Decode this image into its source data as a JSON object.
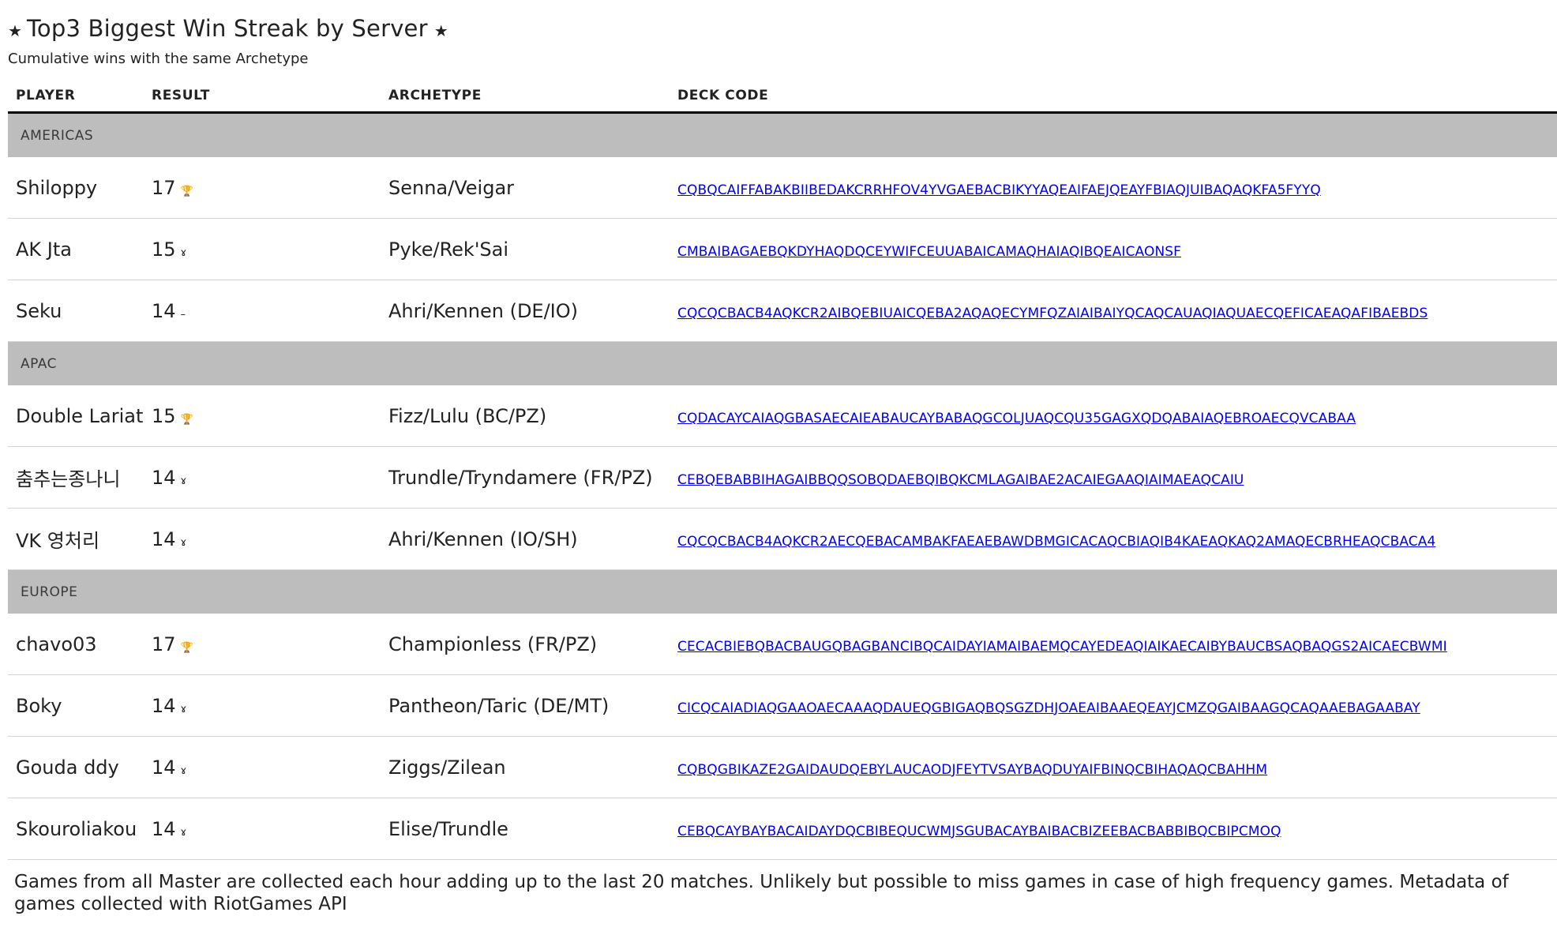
{
  "header": {
    "title": "Top3 Biggest Win Streak by Server",
    "subtitle": "Cumulative wins with the same Archetype",
    "star_icon": "★"
  },
  "table": {
    "columns": [
      "PLAYER",
      "RESULT",
      "ARCHETYPE",
      "DECK CODE"
    ],
    "groups": [
      {
        "name": "AMERICAS",
        "rows": [
          {
            "player": "Shiloppy",
            "result": "17",
            "icon": "trophy-icon",
            "archetype": "Senna/Veigar",
            "deck": "CQBQCAIFFABAKBIIBEDAKCRRHFOV4YVGAEBACBIKYYAQEAIFAEJQEAYFBIAQJUIBAQAQKFA5FYYQ"
          },
          {
            "player": "AK Jta",
            "result": "15",
            "icon": "medal-icon",
            "archetype": "Pyke/Rek'Sai",
            "deck": "CMBAIBAGAEBQKDYHAQDQCEYWIFCEUUABAICAMAQHAIAQIBQEAICAONSF"
          },
          {
            "player": "Seku",
            "result": "14",
            "icon": "dash-icon",
            "archetype": "Ahri/Kennen (DE/IO)",
            "deck": "CQCQCBACB4AQKCR2AIBQEBIUAICQEBA2AQAQECYMFQZAIAIBAIYQCAQCAUAQIAQUAECQEFICAEAQAFIBAEBDS"
          }
        ]
      },
      {
        "name": "APAC",
        "rows": [
          {
            "player": "Double Lariat",
            "result": "15",
            "icon": "trophy-icon",
            "archetype": "Fizz/Lulu (BC/PZ)",
            "deck": "CQDACAYCAIAQGBASAECAIEABAUCAYBABAQGCOLJUAQCQU35GAGXQDQABAIAQEBROAECQVCABAA"
          },
          {
            "player": "춤추는종나니",
            "result": "14",
            "icon": "medal-icon",
            "archetype": "Trundle/Tryndamere (FR/PZ)",
            "deck": "CEBQEBABBIHAGAIBBQQSOBQDAEBQIBQKCMLAGAIBAE2ACAIEGAAQIAIMAEAQCAIU"
          },
          {
            "player": "VK 영처리",
            "result": "14",
            "icon": "medal-icon",
            "archetype": "Ahri/Kennen (IO/SH)",
            "deck": "CQCQCBACB4AQKCR2AECQEBACAMBAKFAEAEBAWDBMGICACAQCBIAQIB4KAEAQKAQ2AMAQECBRHEAQCBACA4"
          }
        ]
      },
      {
        "name": "EUROPE",
        "rows": [
          {
            "player": "chavo03",
            "result": "17",
            "icon": "trophy-icon",
            "archetype": "Championless (FR/PZ)",
            "deck": "CECACBIEBQBACBAUGQBAGBANCIBQCAIDAYIAMAIBAEMQCAYEDEAQIAIKAECAIBYBAUCBSAQBAQGS2AICAECBWMI"
          },
          {
            "player": "Boky",
            "result": "14",
            "icon": "medal-icon",
            "archetype": "Pantheon/Taric (DE/MT)",
            "deck": "CICQCAIADIAQGAAOAECAAAQDAUEQGBIGAQBQSGZDHJOAEAIBAAEQEAYJCMZQGAIBAAGQCAQAAEBAGAABAY"
          },
          {
            "player": "Gouda ddy",
            "result": "14",
            "icon": "medal-icon",
            "archetype": "Ziggs/Zilean",
            "deck": "CQBQGBIKAZE2GAIDAUDQEBYLAUCAODJFEYTVSAYBAQDUYAIFBINQCBIHAQAQCBAHHM"
          },
          {
            "player": "Skouroliakou",
            "result": "14",
            "icon": "medal-icon",
            "archetype": "Elise/Trundle",
            "deck": "CEBQCAYBAYBACAIDAYDQCBIBEQUCWMJSGUBACAYBAIBACBIZEEBACBABBIBQCBIPCMOQ"
          }
        ]
      }
    ]
  },
  "footer": {
    "text": "Games from all Master are collected each hour adding up to the last 20 matches. Unlikely but possible to miss games in case of high frequency games. Metadata of games collected with RiotGames API"
  },
  "icons": {
    "trophy-icon": "🏆",
    "medal-icon": "ɤ",
    "dash-icon": "–"
  }
}
